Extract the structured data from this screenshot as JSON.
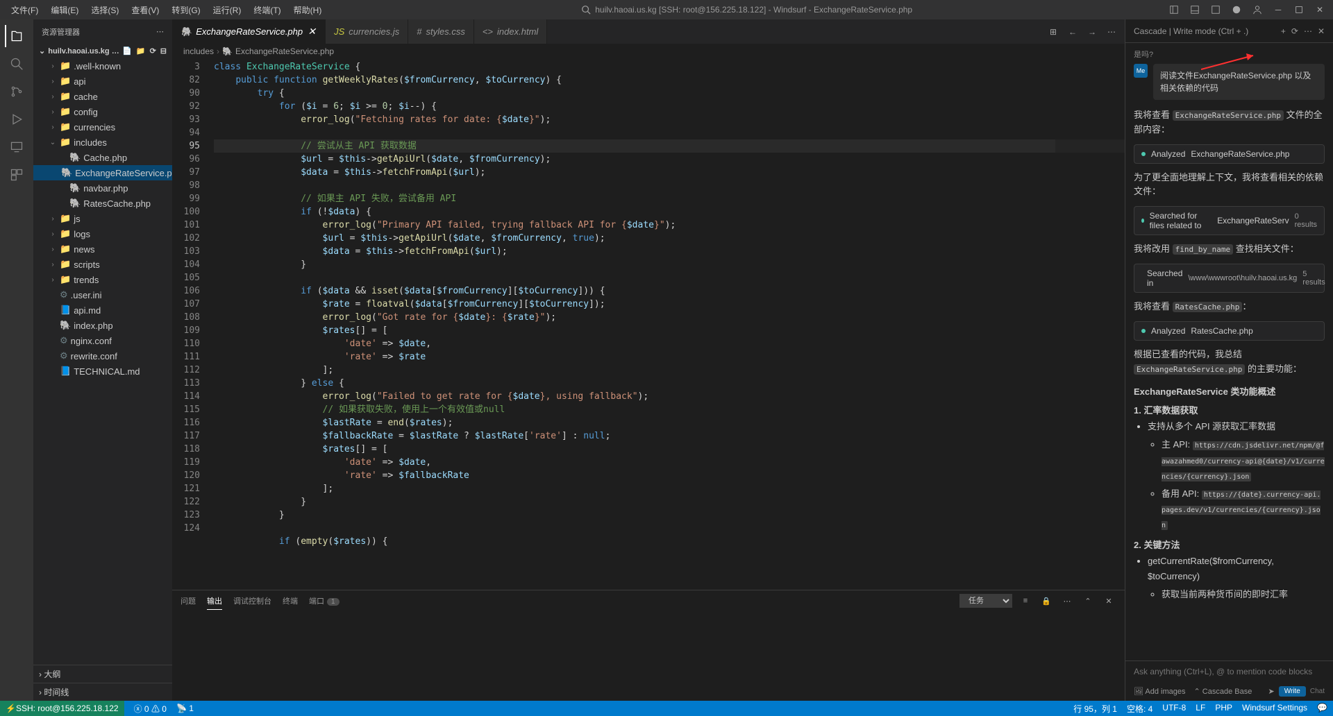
{
  "titlebar": {
    "menus": [
      "文件(F)",
      "编辑(E)",
      "选择(S)",
      "查看(V)",
      "转到(G)",
      "运行(R)",
      "终端(T)",
      "帮助(H)"
    ],
    "center": "huilv.haoai.us.kg [SSH: root@156.225.18.122] - Windsurf - ExchangeRateService.php"
  },
  "sidebar": {
    "header": "资源管理器",
    "project": "huilv.haoai.us.kg [SSH: ro...",
    "tree": [
      {
        "type": "folder",
        "name": ".well-known",
        "depth": 1
      },
      {
        "type": "folder",
        "name": "api",
        "depth": 1
      },
      {
        "type": "folder",
        "name": "cache",
        "depth": 1
      },
      {
        "type": "folder",
        "name": "config",
        "depth": 1
      },
      {
        "type": "folder",
        "name": "currencies",
        "depth": 1
      },
      {
        "type": "folder",
        "name": "includes",
        "depth": 1,
        "expanded": true
      },
      {
        "type": "file",
        "name": "Cache.php",
        "depth": 2,
        "icon": "php"
      },
      {
        "type": "file",
        "name": "ExchangeRateService.php",
        "depth": 2,
        "icon": "php",
        "active": true
      },
      {
        "type": "file",
        "name": "navbar.php",
        "depth": 2,
        "icon": "php"
      },
      {
        "type": "file",
        "name": "RatesCache.php",
        "depth": 2,
        "icon": "php"
      },
      {
        "type": "folder",
        "name": "js",
        "depth": 1
      },
      {
        "type": "folder",
        "name": "logs",
        "depth": 1
      },
      {
        "type": "folder",
        "name": "news",
        "depth": 1
      },
      {
        "type": "folder",
        "name": "scripts",
        "depth": 1
      },
      {
        "type": "folder",
        "name": "trends",
        "depth": 1
      },
      {
        "type": "file",
        "name": ".user.ini",
        "depth": 1,
        "icon": "conf"
      },
      {
        "type": "file",
        "name": "api.md",
        "depth": 1,
        "icon": "md"
      },
      {
        "type": "file",
        "name": "index.php",
        "depth": 1,
        "icon": "php"
      },
      {
        "type": "file",
        "name": "nginx.conf",
        "depth": 1,
        "icon": "conf"
      },
      {
        "type": "file",
        "name": "rewrite.conf",
        "depth": 1,
        "icon": "conf"
      },
      {
        "type": "file",
        "name": "TECHNICAL.md",
        "depth": 1,
        "icon": "md"
      }
    ],
    "outline": "大纲",
    "timeline": "时间线"
  },
  "tabs": [
    {
      "name": "ExchangeRateService.php",
      "icon": "php",
      "active": true
    },
    {
      "name": "currencies.js",
      "icon": "js"
    },
    {
      "name": "styles.css",
      "icon": "css"
    },
    {
      "name": "index.html",
      "icon": "html"
    }
  ],
  "breadcrumb": [
    "includes",
    "ExchangeRateService.php"
  ],
  "lineNumbers": [
    3,
    82,
    90,
    92,
    93,
    94,
    95,
    96,
    97,
    98,
    99,
    100,
    101,
    102,
    103,
    104,
    105,
    106,
    107,
    108,
    109,
    110,
    111,
    112,
    113,
    114,
    115,
    116,
    117,
    118,
    119,
    120,
    121,
    122,
    123,
    124
  ],
  "currentLine": 95,
  "panel": {
    "tabs": [
      "问题",
      "输出",
      "调试控制台",
      "终端",
      "端口"
    ],
    "activeTab": "输出",
    "portBadge": "1",
    "dropdown": "任务"
  },
  "cascade": {
    "header": "Cascade | Write mode (Ctrl + .)",
    "topText": "是吗?",
    "userMsg": "阅读文件ExchangeRateService.php 以及相关依赖的代码",
    "lines": {
      "l1_pre": "我将查看 ",
      "l1_code": "ExchangeRateService.php",
      "l1_post": " 文件的全部内容：",
      "a1_label": "Analyzed",
      "a1_code": "ExchangeRateService.php",
      "l2": "为了更全面地理解上下文，我将查看相关的依赖文件：",
      "a2_label": "Searched for files related to",
      "a2_code": "ExchangeRateServ",
      "a2_right": "0 results",
      "l3_pre": "我将改用 ",
      "l3_code": "find_by_name",
      "l3_post": " 查找相关文件：",
      "a3_label": "Searched in",
      "a3_path": "\\www\\wwwroot\\huilv.haoai.us.kg",
      "a3_right": "5 results",
      "l4_pre": "我将查看 ",
      "l4_code": "RatesCache.php",
      "l4_post": "：",
      "a4_label": "Analyzed",
      "a4_code": "RatesCache.php",
      "l5_pre": "根据已查看的代码，我总结 ",
      "l5_code": "ExchangeRateService.php",
      "l5_post": " 的主要功能：",
      "heading": "ExchangeRateService 类功能概述",
      "h1": "1. 汇率数据获取",
      "b1": "支持从多个 API 源获取汇率数据",
      "b1a": "主 API:",
      "b1a_url": "https://cdn.jsdelivr.net/npm/@fawazahmed0/currency-api@{date}/v1/currencies/{currency}.json",
      "b1b": "备用 API:",
      "b1b_url": "https://{date}.currency-api.pages.dev/v1/currencies/{currency}.json",
      "h2": "2. 关键方法",
      "b2_code": "getCurrentRate($fromCurrency, $toCurrency)",
      "b2_sub": "获取当前两种货币间的即时汇率"
    },
    "inputPlaceholder": "Ask anything (Ctrl+L), @ to mention code blocks",
    "footer": {
      "addImages": "Add images",
      "model": "Cascade Base",
      "write": "Write",
      "chat": "Chat"
    }
  },
  "statusbar": {
    "remote": "SSH: root@156.225.18.122",
    "errors": "0",
    "warnings": "0",
    "ports": "1",
    "position": "行 95，列 1",
    "spaces": "空格: 4",
    "encoding": "UTF-8",
    "eol": "LF",
    "lang": "PHP",
    "settings": "Windsurf Settings"
  }
}
